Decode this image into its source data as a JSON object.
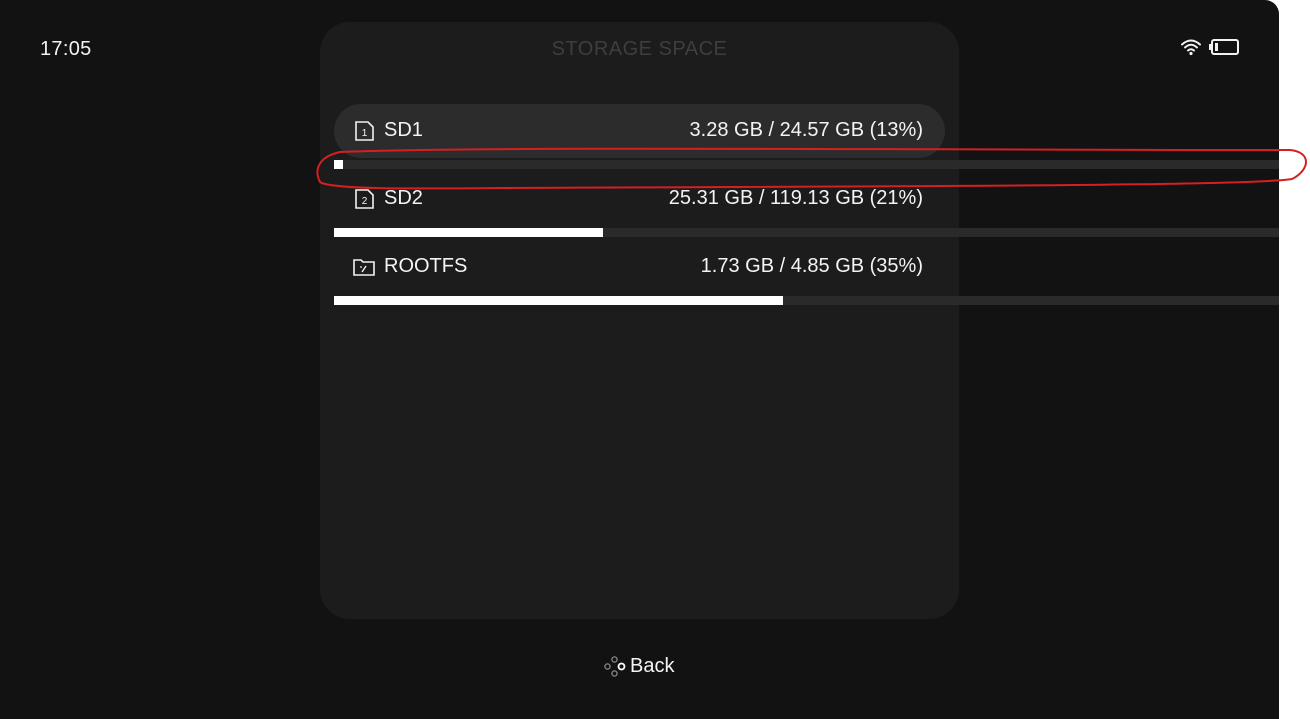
{
  "status": {
    "time": "17:05",
    "wifi_icon": "wifi-icon",
    "battery_icon": "battery-icon"
  },
  "panel": {
    "title": "STORAGE SPACE"
  },
  "storage": [
    {
      "label": "SD1",
      "usage": "3.28 GB / 24.57 GB (13%)",
      "icon": "sd-card-1-icon",
      "fill_fraction": 0.01,
      "selected": true
    },
    {
      "label": "SD2",
      "usage": "25.31 GB / 119.13 GB (21%)",
      "icon": "sd-card-2-icon",
      "fill_fraction": 0.285,
      "selected": false
    },
    {
      "label": "ROOTFS",
      "usage": "1.73 GB / 4.85 GB (35%)",
      "icon": "folder-root-icon",
      "fill_fraction": 0.475,
      "selected": false
    }
  ],
  "footer": {
    "back_label": "Back",
    "back_icon": "gamepad-button-icon"
  },
  "colors": {
    "background": "#121212",
    "panel": "#1c1c1c",
    "selected_row": "#2c2c2c",
    "bar_track": "#2a2a2a",
    "bar_fill": "#ffffff",
    "annotation": "#d42020"
  }
}
